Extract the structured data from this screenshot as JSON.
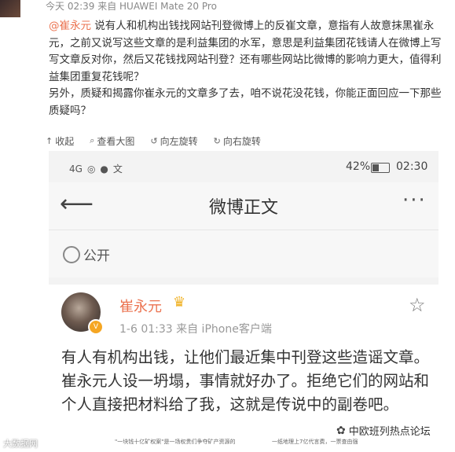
{
  "header": {
    "meta": "今天 02:39 来自 HUAWEI Mate 20 Pro"
  },
  "comment": {
    "mention": "@崔永元",
    "text": " 说有人和机构出钱找网站刊登微博上的反崔文章，意指有人故意抹黑崔永元，之前又说写这些文章的是利益集团的水军，意思是利益集团花钱请人在微博上写写文章反对你，然后又花钱找网站刊登？还有哪些网站比微博的影响力更大，值得利益集团重复花钱呢？",
    "text2": "另外，质疑和揭露你崔永元的文章多了去，咱不说花没花钱，你能正面回应一下那些质疑吗？"
  },
  "toolbar": {
    "collapse": "收起",
    "view_large": "查看大图",
    "rotate_left": "向左旋转",
    "rotate_right": "向右旋转"
  },
  "phone": {
    "status": {
      "signal": "4G",
      "battery_pct": "42%",
      "battery_level": 0.42,
      "time": "02:30"
    },
    "nav_title": "微博正文",
    "visibility": "公开",
    "post": {
      "user": "崔永元",
      "meta": "1-6 01:33  来自 iPhone客户端",
      "text": "有人有机构出钱，让他们最近集中刊登这些造谣文章。崔永元人设一坍塌，事情就好办了。拒绝它们的网站和个人直接把材料给了我，这就是传说中的副卷吧。"
    }
  },
  "watermarks": {
    "left": "大数据网",
    "right": "中欧班列热点论坛",
    "note1": "\"一块钱十亿矿权案\"是一场权贵们争夺矿产资源的",
    "note2": "一纸地理上7亿代言费，一票查由强"
  },
  "icons": {
    "collapse": "collapse-arrow-icon",
    "view_large": "magnifier-icon",
    "rotate_left": "rotate-left-icon",
    "rotate_right": "rotate-right-icon",
    "back": "back-arrow-icon",
    "more": "more-dots-icon",
    "globe": "globe-icon",
    "star": "star-icon",
    "crown": "crown-icon",
    "wechat": "wechat-icon"
  },
  "colors": {
    "accent": "#eb7350",
    "crown": "#f0b020"
  }
}
